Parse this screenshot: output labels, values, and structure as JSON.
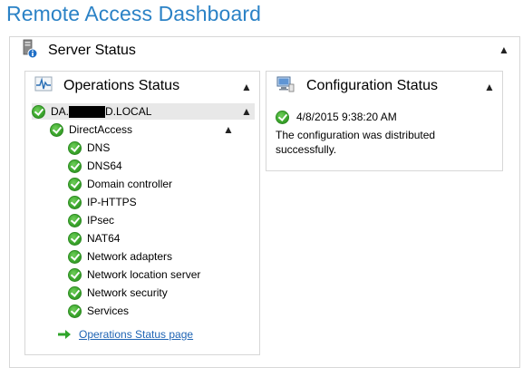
{
  "page": {
    "title": "Remote Access Dashboard"
  },
  "server_status": {
    "label": "Server Status",
    "icon": "server-info-icon",
    "collapse_icon": "caret-up-icon"
  },
  "operations": {
    "label": "Operations Status",
    "icon": "heartbeat-monitor-icon",
    "server_prefix": "DA.",
    "server_suffix": "D.LOCAL",
    "group": "DirectAccess",
    "components": [
      "DNS",
      "DNS64",
      "Domain controller",
      "IP-HTTPS",
      "IPsec",
      "NAT64",
      "Network adapters",
      "Network location server",
      "Network security",
      "Services"
    ],
    "link_label": "Operations Status page",
    "link_icon": "green-arrow-icon"
  },
  "configuration": {
    "label": "Configuration Status",
    "icon": "computer-config-icon",
    "timestamp": "4/8/2015 9:38:20 AM",
    "message": "The configuration was distributed successfully."
  },
  "colors": {
    "title": "#2b82c6",
    "link": "#1f64b4",
    "ok": "#3da82e"
  }
}
